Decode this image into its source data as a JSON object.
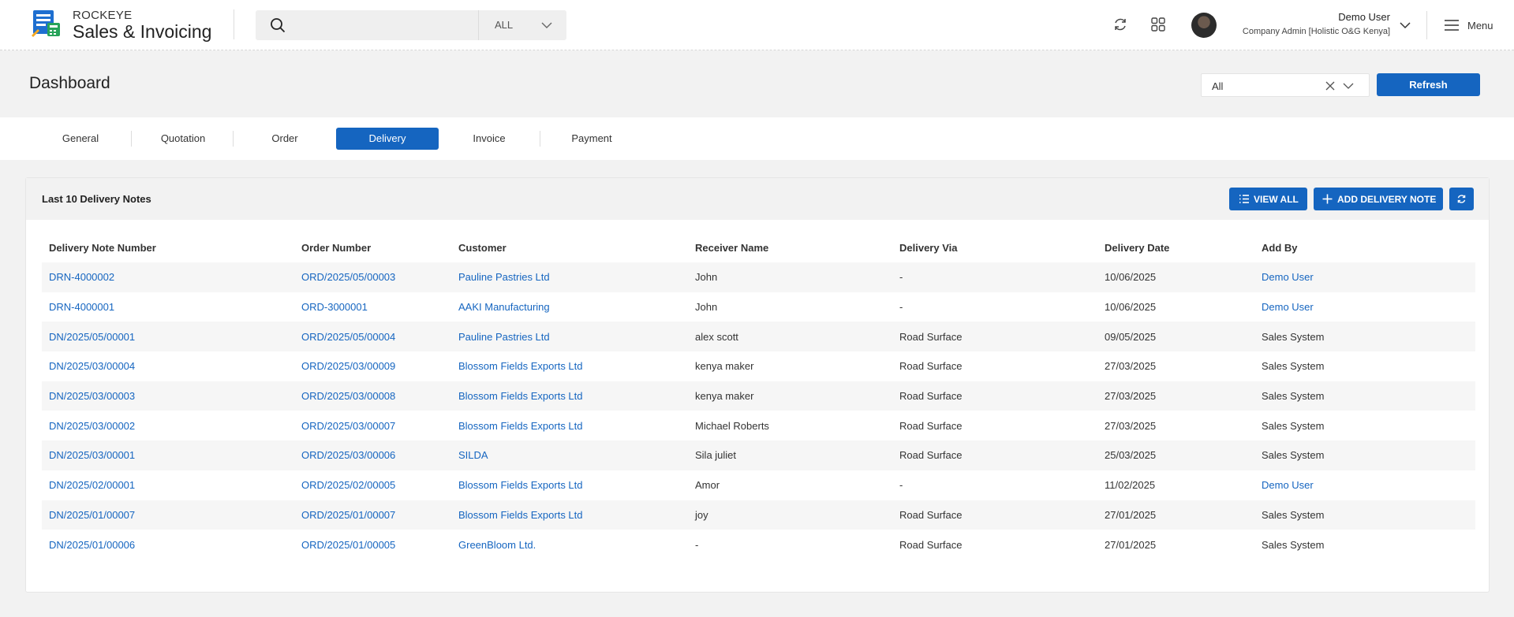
{
  "brand": {
    "top": "ROCKEYE",
    "name": "Sales & Invoicing"
  },
  "search": {
    "value": "",
    "placeholder": "",
    "scope": "ALL"
  },
  "user": {
    "name": "Demo User",
    "role": "Company Admin [Holistic O&G Kenya]"
  },
  "menu_label": "Menu",
  "page_title": "Dashboard",
  "filter_value": "All",
  "refresh_label": "Refresh",
  "tabs": [
    {
      "label": "General"
    },
    {
      "label": "Quotation"
    },
    {
      "label": "Order"
    },
    {
      "label": "Delivery",
      "active": true
    },
    {
      "label": "Invoice"
    },
    {
      "label": "Payment"
    }
  ],
  "card": {
    "title": "Last 10 Delivery Notes",
    "view_all": "VIEW ALL",
    "add_note": "ADD DELIVERY NOTE"
  },
  "table": {
    "columns": [
      "Delivery Note Number",
      "Order Number",
      "Customer",
      "Receiver Name",
      "Delivery Via",
      "Delivery Date",
      "Add By"
    ],
    "rows": [
      [
        "DRN-4000002",
        "ORD/2025/05/00003",
        "Pauline Pastries Ltd",
        "John",
        "-",
        "10/06/2025",
        "Demo User"
      ],
      [
        "DRN-4000001",
        "ORD-3000001",
        "AAKI Manufacturing",
        "John",
        "-",
        "10/06/2025",
        "Demo User"
      ],
      [
        "DN/2025/05/00001",
        "ORD/2025/05/00004",
        "Pauline Pastries Ltd",
        "alex scott",
        "Road Surface",
        "09/05/2025",
        "Sales System"
      ],
      [
        "DN/2025/03/00004",
        "ORD/2025/03/00009",
        "Blossom Fields Exports Ltd",
        "kenya maker",
        "Road Surface",
        "27/03/2025",
        "Sales System"
      ],
      [
        "DN/2025/03/00003",
        "ORD/2025/03/00008",
        "Blossom Fields Exports Ltd",
        "kenya maker",
        "Road Surface",
        "27/03/2025",
        "Sales System"
      ],
      [
        "DN/2025/03/00002",
        "ORD/2025/03/00007",
        "Blossom Fields Exports Ltd",
        "Michael Roberts",
        "Road Surface",
        "27/03/2025",
        "Sales System"
      ],
      [
        "DN/2025/03/00001",
        "ORD/2025/03/00006",
        "SILDA",
        "Sila juliet",
        "Road Surface",
        "25/03/2025",
        "Sales System"
      ],
      [
        "DN/2025/02/00001",
        "ORD/2025/02/00005",
        "Blossom Fields Exports Ltd",
        "Amor",
        "-",
        "11/02/2025",
        "Demo User"
      ],
      [
        "DN/2025/01/00007",
        "ORD/2025/01/00007",
        "Blossom Fields Exports Ltd",
        "joy",
        "Road Surface",
        "27/01/2025",
        "Sales System"
      ],
      [
        "DN/2025/01/00006",
        "ORD/2025/01/00005",
        "GreenBloom Ltd.",
        "-",
        "Road Surface",
        "27/01/2025",
        "Sales System"
      ]
    ]
  },
  "colors": {
    "accent": "#1565c0",
    "link": "#1565c0",
    "background": "#f2f2f2"
  }
}
